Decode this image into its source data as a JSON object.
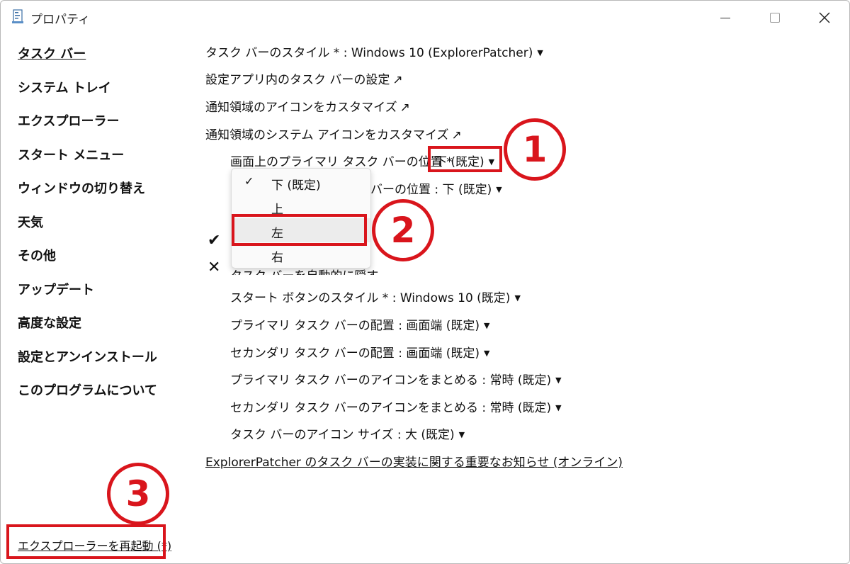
{
  "window": {
    "title": "プロパティ"
  },
  "sidebar": {
    "items": [
      {
        "label": "タスク バー"
      },
      {
        "label": "システム トレイ"
      },
      {
        "label": "エクスプローラー"
      },
      {
        "label": "スタート メニュー"
      },
      {
        "label": "ウィンドウの切り替え"
      },
      {
        "label": "天気"
      },
      {
        "label": "その他"
      },
      {
        "label": "アップデート"
      },
      {
        "label": "高度な設定"
      },
      {
        "label": "設定とアンインストール"
      },
      {
        "label": "このプログラムについて"
      }
    ],
    "restart_link": "エクスプローラーを再起動 (*)"
  },
  "content": {
    "taskbar_style": "タスク バーのスタイル * : Windows 10 (ExplorerPatcher)",
    "settings_app_link": "設定アプリ内のタスク バーの設定",
    "notify_icons_link": "通知領域のアイコンをカスタマイズ",
    "system_icons_link": "通知領域のシステム アイコンをカスタマイズ",
    "primary_pos_label": "画面上のプライマリ タスク バーの位置 *",
    "primary_pos_value": "下 (既定)",
    "secondary_pos_partial": "バーの位置 : 下 (既定)",
    "autohide_partial": "タスク バーを自動的に隠す",
    "start_button_style": "スタート ボタンのスタイル * : Windows 10 (既定)",
    "primary_alignment": "プライマリ タスク バーの配置 : 画面端 (既定)",
    "secondary_alignment": "セカンダリ タスク バーの配置 : 画面端 (既定)",
    "primary_combine": "プライマリ タスク バーのアイコンをまとめる : 常時 (既定)",
    "secondary_combine": "セカンダリ タスク バーのアイコンをまとめる : 常時 (既定)",
    "icon_size": "タスク バーのアイコン サイズ : 大 (既定)",
    "important_notice_link": "ExplorerPatcher のタスク バーの実装に関する重要なお知らせ (オンライン)"
  },
  "dropdown": {
    "options": [
      "下 (既定)",
      "上",
      "左",
      "右"
    ],
    "checked_index": 0,
    "highlighted_index": 2
  },
  "annotations": {
    "badge1": "1",
    "badge2": "2",
    "badge3": "3",
    "accent_color": "#d9151c"
  }
}
